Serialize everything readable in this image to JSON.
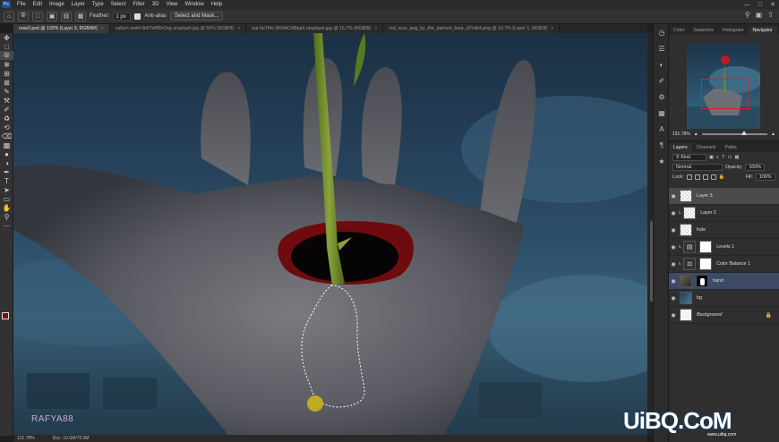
{
  "menu": [
    "File",
    "Edit",
    "Image",
    "Layer",
    "Type",
    "Select",
    "Filter",
    "3D",
    "View",
    "Window",
    "Help"
  ],
  "options_bar": {
    "feather_label": "Feather:",
    "feather_value": "1 px",
    "antialias_label": "Anti-alias",
    "select_mask_label": "Select and Mask..."
  },
  "tabs": [
    {
      "label": "rose2.psd @ 132% (Layer 3, RGB/8#)",
      "active": true
    },
    {
      "label": "callum smith BdTlvBBhOsg unsplash.jpg @ 50% (RGB/8)",
      "active": false
    },
    {
      "label": "tua hoTfrlo D6XACdl9pp4 unsplash.jpg @ 16.7% (RGB/8)",
      "active": false
    },
    {
      "label": "red_rose_png_by_the_darkest_hour_d7cdb4.png @ 16.7% (Layer 1, RGB/8)",
      "active": false
    }
  ],
  "status": {
    "zoom": "131.78%",
    "doc": "Doc: 10.0M/70.0M"
  },
  "canvas_watermark": "RAFYA88",
  "navigator": {
    "tabs": [
      "Color",
      "Swatches",
      "Histogram",
      "Navigator"
    ],
    "active_tab": "Navigator",
    "zoom": "131.78%"
  },
  "layers_panel": {
    "tabs": [
      "Layers",
      "Channels",
      "Paths"
    ],
    "active_tab": "Layers",
    "kind": "Kind",
    "blend_mode": "Normal",
    "opacity_label": "Opacity:",
    "opacity": "100%",
    "lock_label": "Lock:",
    "fill_label": "Fill:",
    "fill": "100%",
    "layers": [
      {
        "name": "Layer 3",
        "thumb": "check",
        "state": "active",
        "mask": ""
      },
      {
        "name": "Layer 2",
        "thumb": "check",
        "state": "",
        "mask": ""
      },
      {
        "name": "hole",
        "thumb": "check",
        "state": "",
        "mask": ""
      },
      {
        "name": "Levels 1",
        "thumb": "adj",
        "state": "",
        "mask": "white"
      },
      {
        "name": "Color Balance 1",
        "thumb": "adj",
        "state": "",
        "mask": "white"
      },
      {
        "name": "hand",
        "thumb": "dark",
        "state": "sel",
        "mask": "hand"
      },
      {
        "name": "bg",
        "thumb": "blue",
        "state": "",
        "mask": ""
      },
      {
        "name": "Background",
        "thumb": "white",
        "state": "",
        "mask": "",
        "italic": true,
        "locked": true
      }
    ]
  },
  "site_watermark": {
    "main": "UiBQ.CoM",
    "sub": "www.uibq.com"
  }
}
